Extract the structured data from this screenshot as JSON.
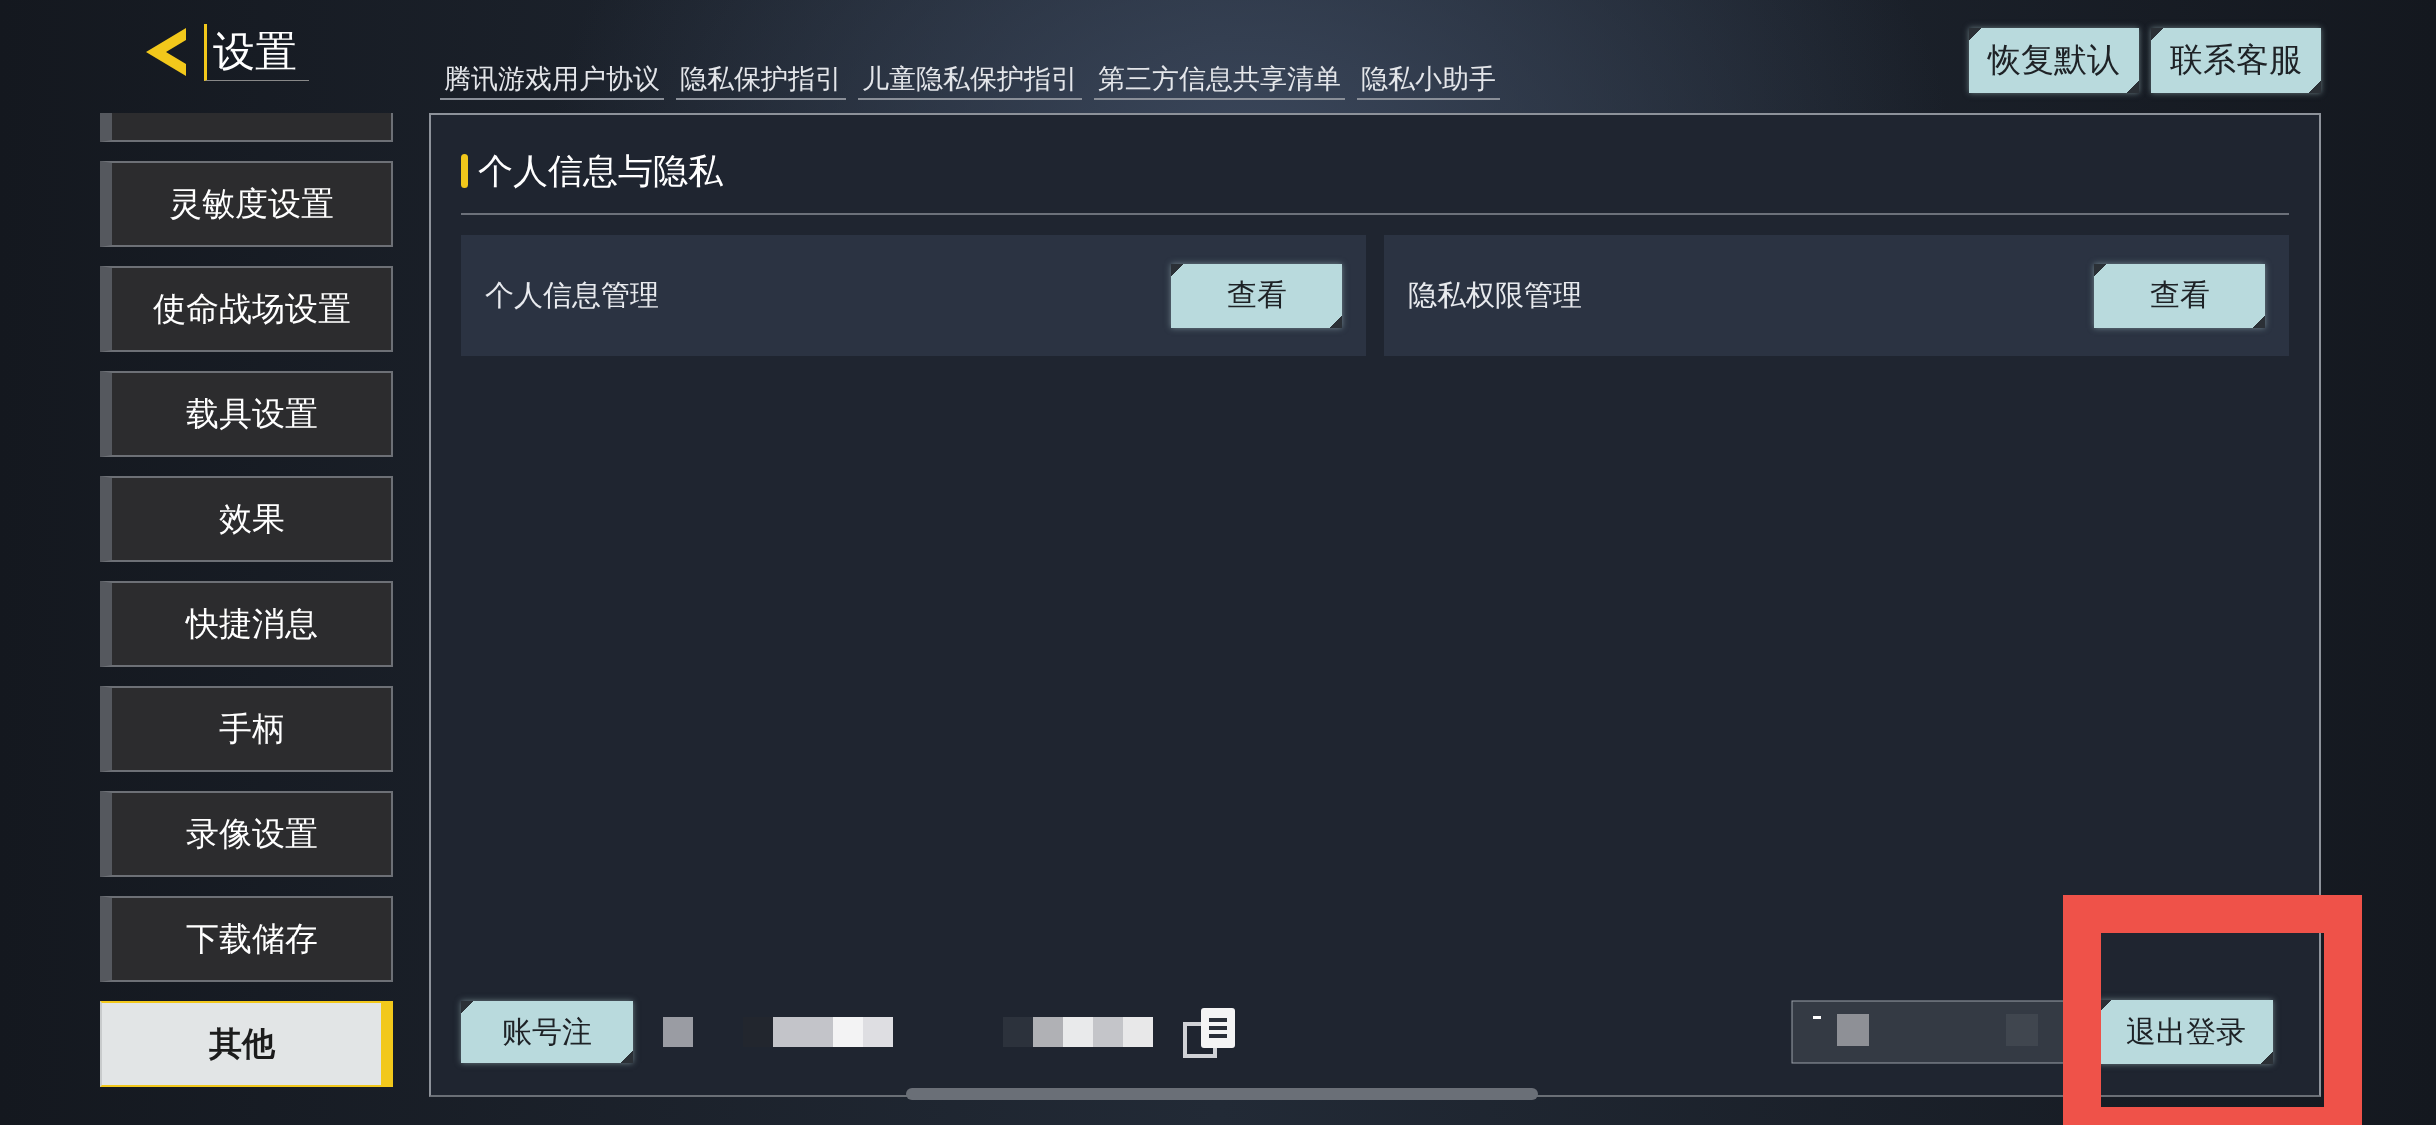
{
  "header": {
    "title": "设置"
  },
  "sidebar": {
    "items": [
      {
        "label": "灵敏度设置",
        "selected": false
      },
      {
        "label": "使命战场设置",
        "selected": false
      },
      {
        "label": "载具设置",
        "selected": false
      },
      {
        "label": "效果",
        "selected": false
      },
      {
        "label": "快捷消息",
        "selected": false
      },
      {
        "label": "手柄",
        "selected": false
      },
      {
        "label": "录像设置",
        "selected": false
      },
      {
        "label": "下载储存",
        "selected": false
      },
      {
        "label": "其他",
        "selected": true
      }
    ]
  },
  "links": [
    "腾讯游戏用户协议",
    "隐私保护指引",
    "儿童隐私保护指引",
    "第三方信息共享清单",
    "隐私小助手"
  ],
  "top_buttons": [
    "恢复默认",
    "联系客服"
  ],
  "panel": {
    "heading": "个人信息与隐私",
    "cards": [
      {
        "label": "个人信息管理",
        "button": "查看"
      },
      {
        "label": "隐私权限管理",
        "button": "查看"
      }
    ]
  },
  "footer": {
    "cancel_button": "账号注",
    "logout_button": "退出登录"
  }
}
